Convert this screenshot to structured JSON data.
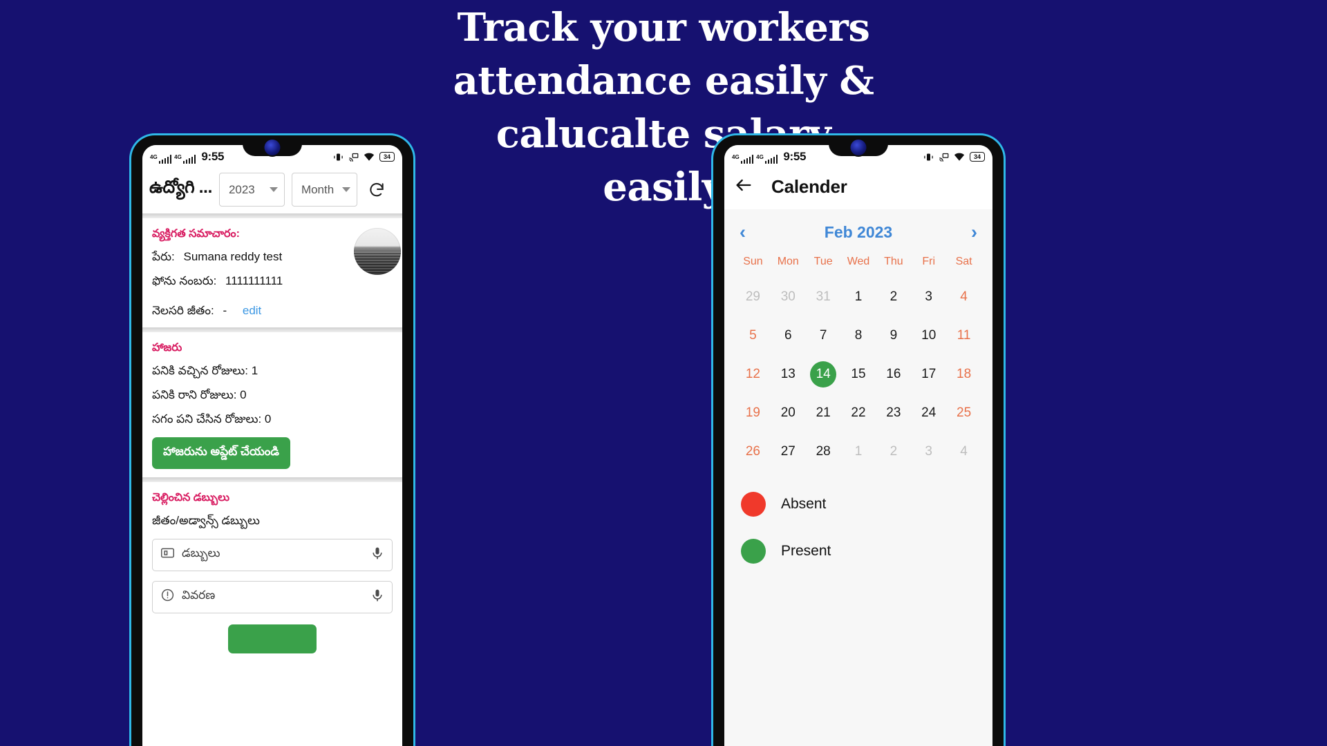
{
  "page": {
    "background_color": "#161170",
    "headline_lines": [
      "Track your workers",
      "attendance easily &",
      "calucalte salary",
      "easily"
    ]
  },
  "left_phone": {
    "status_bar": {
      "network_label_1": "4G",
      "network_label_2": "4G",
      "time": "9:55",
      "battery": "34",
      "icons": [
        "vibrate-icon",
        "cast-icon",
        "wifi-icon",
        "battery-icon"
      ]
    },
    "toolbar": {
      "title": "ఉద్యోగి ...",
      "year_value": "2023",
      "month_placeholder": "Month",
      "refresh_icon": "refresh-icon"
    },
    "personal_section": {
      "heading": "వ్యక్తిగత సమాచారం:",
      "name_label": "పేరు:",
      "name_value": "Sumana reddy test",
      "phone_label": "ఫోను నంబరు:",
      "phone_value": "1111111111",
      "salary_label": "నెలసరి జీతం:",
      "salary_value": "-",
      "edit_link": "edit"
    },
    "attendance_section": {
      "heading": "హాజరు",
      "present_label": "పనికి వచ్చిన రోజులు: 1",
      "absent_label": "పనికి రాని రోజులు: 0",
      "halfday_label": "సగం పని చేసిన రోజులు: 0",
      "update_button": "హాజరును అప్డేట్ చేయండి",
      "update_button_color": "#3aa14a"
    },
    "payments_section": {
      "heading": "చెల్లించిన డబ్బులు",
      "subheading": "జీతం/అడ్వాన్స్ డబ్బులు",
      "amount_placeholder": "డబ్బులు",
      "amount_icon": "money-icon",
      "description_placeholder": "వివరణ",
      "description_icon": "info-icon",
      "mic_icon": "mic-icon"
    }
  },
  "right_phone": {
    "status_bar": {
      "network_label_1": "4G",
      "network_label_2": "4G",
      "time": "9:55",
      "battery": "34",
      "icons": [
        "vibrate-icon",
        "cast-icon",
        "wifi-icon",
        "battery-icon"
      ]
    },
    "appbar": {
      "back_icon": "back-arrow-icon",
      "title": "Calender"
    },
    "calendar": {
      "prev_icon": "chevron-left-icon",
      "next_icon": "chevron-right-icon",
      "month_label": "Feb 2023",
      "month_color": "#3f87d6",
      "weekday_color": "#e8714a",
      "weekdays": [
        "Sun",
        "Mon",
        "Tue",
        "Wed",
        "Thu",
        "Fri",
        "Sat"
      ],
      "selected_day": 14,
      "selected_color": "#3aa14a",
      "weeks": [
        [
          {
            "d": "29",
            "type": "muted"
          },
          {
            "d": "30",
            "type": "muted"
          },
          {
            "d": "31",
            "type": "muted"
          },
          {
            "d": "1",
            "type": "normal"
          },
          {
            "d": "2",
            "type": "normal"
          },
          {
            "d": "3",
            "type": "normal"
          },
          {
            "d": "4",
            "type": "weekend"
          }
        ],
        [
          {
            "d": "5",
            "type": "weekend"
          },
          {
            "d": "6",
            "type": "normal"
          },
          {
            "d": "7",
            "type": "normal"
          },
          {
            "d": "8",
            "type": "normal"
          },
          {
            "d": "9",
            "type": "normal"
          },
          {
            "d": "10",
            "type": "normal"
          },
          {
            "d": "11",
            "type": "weekend"
          }
        ],
        [
          {
            "d": "12",
            "type": "weekend"
          },
          {
            "d": "13",
            "type": "normal"
          },
          {
            "d": "14",
            "type": "selected"
          },
          {
            "d": "15",
            "type": "normal"
          },
          {
            "d": "16",
            "type": "normal"
          },
          {
            "d": "17",
            "type": "normal"
          },
          {
            "d": "18",
            "type": "weekend"
          }
        ],
        [
          {
            "d": "19",
            "type": "weekend"
          },
          {
            "d": "20",
            "type": "normal"
          },
          {
            "d": "21",
            "type": "normal"
          },
          {
            "d": "22",
            "type": "normal"
          },
          {
            "d": "23",
            "type": "normal"
          },
          {
            "d": "24",
            "type": "normal"
          },
          {
            "d": "25",
            "type": "weekend"
          }
        ],
        [
          {
            "d": "26",
            "type": "weekend"
          },
          {
            "d": "27",
            "type": "normal"
          },
          {
            "d": "28",
            "type": "normal"
          },
          {
            "d": "1",
            "type": "muted"
          },
          {
            "d": "2",
            "type": "muted"
          },
          {
            "d": "3",
            "type": "muted"
          },
          {
            "d": "4",
            "type": "muted"
          }
        ]
      ],
      "legend": [
        {
          "label": "Absent",
          "color": "#f0392b"
        },
        {
          "label": "Present",
          "color": "#3aa14a"
        }
      ]
    }
  }
}
